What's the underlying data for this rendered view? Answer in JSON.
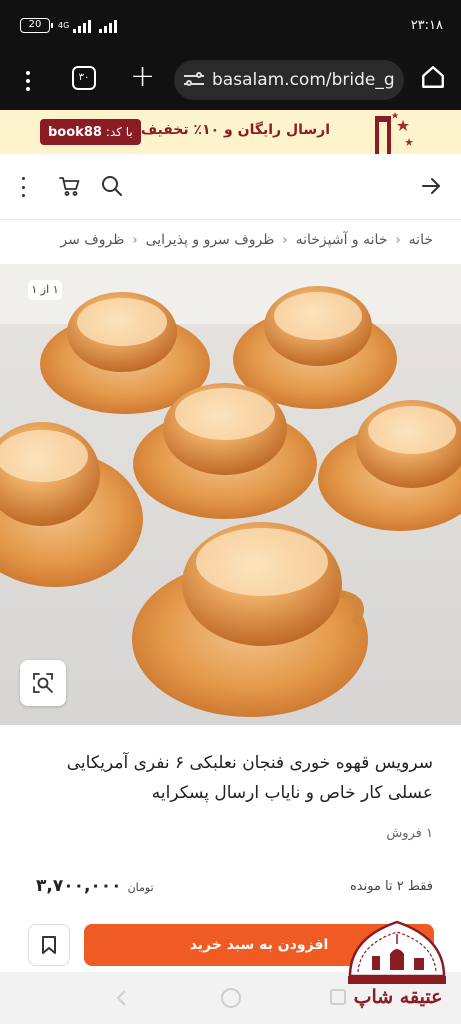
{
  "status_bar": {
    "battery": "20",
    "network": "4G",
    "time": "۲۳:۱۸"
  },
  "browser": {
    "tab_count": "۳۰",
    "url": "basalam.com/bride_g"
  },
  "promo": {
    "code_label": "با کد:",
    "code": "book88",
    "text": "ارسال رایگان و ۱۰٪ تخفیف"
  },
  "breadcrumb": [
    "خانه",
    "خانه و آشپزخانه",
    "ظروف سرو و پذیرایی",
    "ظروف سر"
  ],
  "image_counter": "۱ از ۱",
  "product": {
    "title": "سرویس قهوه خوری فنجان نعلبکی ۶ نفری آمریکایی عسلی کار خاص و نایاب ارسال پسکرایه",
    "sales": "۱ فروش",
    "price": "۳,۷۰۰,۰۰۰",
    "currency": "تومان",
    "stock": "فقط ۲ تا مونده"
  },
  "actions": {
    "add_to_cart": "افزودن به سبد خرید"
  },
  "watermark": {
    "shop_name": "عتیقه شاپ"
  },
  "colors": {
    "accent": "#f05a23",
    "brand": "#8a1c24",
    "promo_bg": "#fdf4cd"
  },
  "icons": [
    "menu-icon",
    "tabs-icon",
    "plus-icon",
    "site-settings-icon",
    "home-icon",
    "more-icon",
    "cart-icon",
    "search-icon",
    "back-arrow-icon",
    "zoom-icon",
    "bookmark-icon"
  ]
}
